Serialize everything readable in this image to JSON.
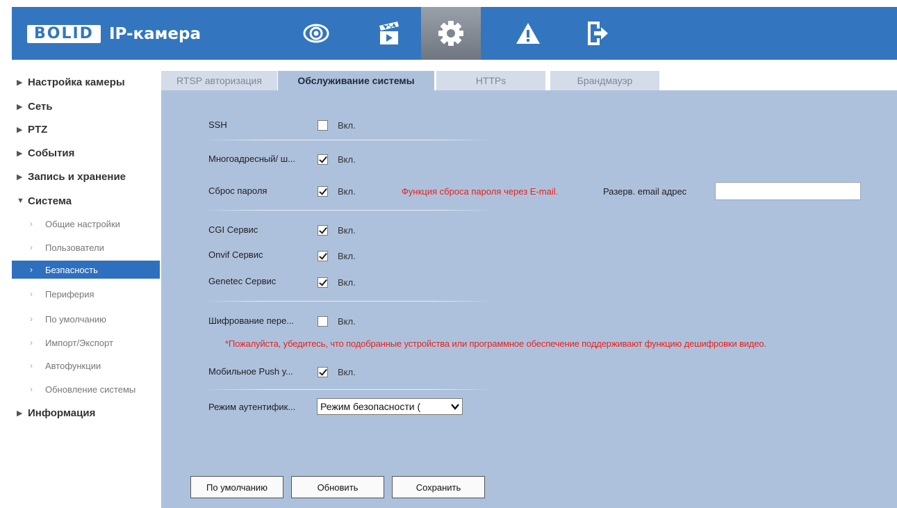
{
  "header": {
    "logo_brand": "BOLID",
    "logo_title": "IP-камера",
    "nav_icons": [
      "eye-icon",
      "clapperboard-icon",
      "gear-icon",
      "warning-icon",
      "logout-icon"
    ],
    "active_nav": "gear-icon"
  },
  "sidebar": {
    "items": [
      {
        "label": "Настройка камеры",
        "expanded": false
      },
      {
        "label": "Сеть",
        "expanded": false
      },
      {
        "label": "PTZ",
        "expanded": false
      },
      {
        "label": "События",
        "expanded": false
      },
      {
        "label": "Запись и хранение",
        "expanded": false
      },
      {
        "label": "Система",
        "expanded": true
      },
      {
        "label": "Информация",
        "expanded": false
      }
    ],
    "subitems": [
      {
        "label": "Общие настройки"
      },
      {
        "label": "Пользователи"
      },
      {
        "label": "Безпасность",
        "active": true
      },
      {
        "label": "Периферия"
      },
      {
        "label": "По умолчанию"
      },
      {
        "label": "Импорт/Экспорт"
      },
      {
        "label": "Автофункции"
      },
      {
        "label": "Обновление системы"
      }
    ]
  },
  "tabs": [
    {
      "label": "RTSP авторизация"
    },
    {
      "label": "Обслуживание системы",
      "active": true
    },
    {
      "label": "HTTPs"
    },
    {
      "label": "Брандмауэр"
    }
  ],
  "form": {
    "on_label": "Вкл.",
    "rows": [
      {
        "label": "SSH",
        "checked": false
      },
      {
        "label": "Многоадресный/ ш...",
        "checked": true
      },
      {
        "label": "Сброс пароля",
        "checked": true
      },
      {
        "label": "CGI Сервис",
        "checked": true
      },
      {
        "label": "Onvif Сервис",
        "checked": true
      },
      {
        "label": "Genetec Сервис",
        "checked": true
      },
      {
        "label": "Шифрование пере...",
        "checked": false
      },
      {
        "label": "Мобильное Push у...",
        "checked": true
      }
    ],
    "reset_note": "Функция сброса пароля через E-mail.",
    "backup_email_label": "Разерв. email адрес",
    "backup_email_value": "",
    "encryption_warning": "*Пожалуйста, убедитесь, что подобранные устройства или программное обеспечение поддерживают функцию дешифровки видео.",
    "auth_mode_label": "Режим аутентифик...",
    "auth_mode_value": "Режим безопасности (",
    "buttons": {
      "default": "По умолчанию",
      "refresh": "Обновить",
      "save": "Сохранить"
    }
  },
  "colors": {
    "header": "#3376bf",
    "content_bg": "#aec1dc",
    "active_item": "#2f6fc0",
    "warning_text": "#e8211c"
  }
}
